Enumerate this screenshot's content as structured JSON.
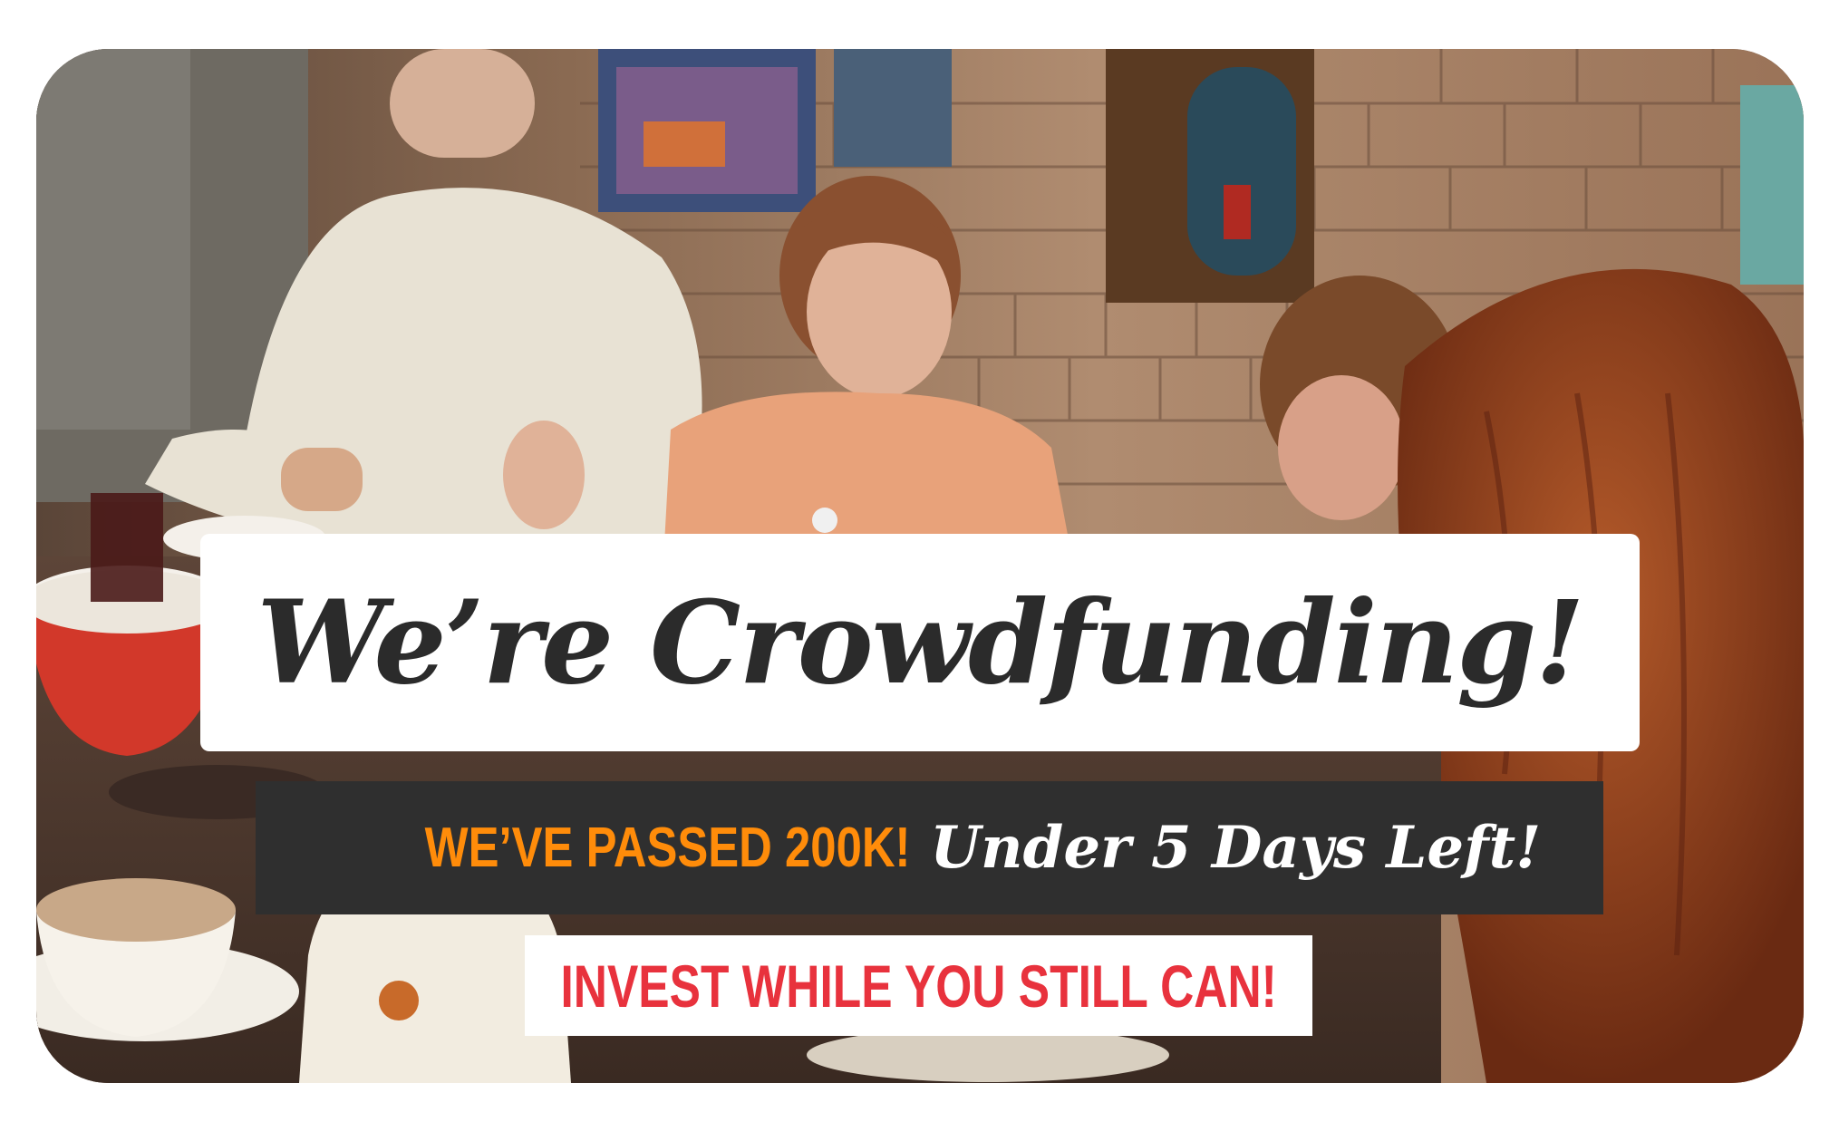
{
  "banner": {
    "headline": "We’re Crowdfunding!",
    "status_passed": "WE’VE PASSED 200K!",
    "status_days": "Under 5 Days Left!",
    "cta": "INVEST WHILE YOU STILL CAN!"
  },
  "colors": {
    "headline_text": "#2b2b2b",
    "status_bar_bg": "#2f2f2f",
    "status_passed_text": "#ff8c0a",
    "status_days_text": "#ffffff",
    "cta_text": "#e8323d"
  },
  "background_photo": {
    "description_icon": "photo-icon"
  }
}
